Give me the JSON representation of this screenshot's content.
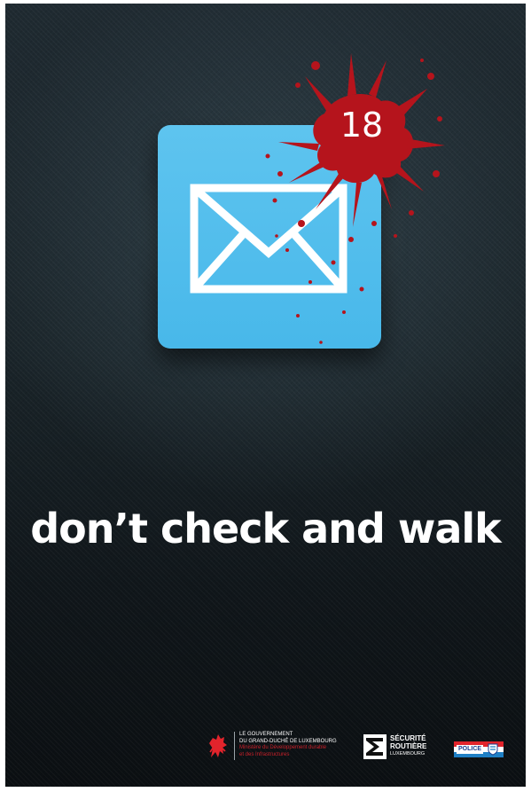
{
  "poster": {
    "slogan": "don’t check and walk",
    "notification": {
      "count": "18",
      "icon": "envelope-icon",
      "tile_color": "#4fbdec",
      "badge_color": "#b5141c"
    }
  },
  "footer": {
    "government": {
      "line1": "LE GOUVERNEMENT",
      "line2": "DU GRAND-DUCHÉ DE LUXEMBOURG",
      "line3": "Ministère du Développement durable",
      "line4": "et des Infrastructures",
      "icon": "lion-icon"
    },
    "securite_routiere": {
      "line1": "SÉCURITÉ",
      "line2": "ROUTIÈRE",
      "line3": "LUXEMBOURG",
      "icon": "road-sign-icon"
    },
    "police": {
      "label": "POLICE",
      "icon": "crest-icon"
    }
  }
}
